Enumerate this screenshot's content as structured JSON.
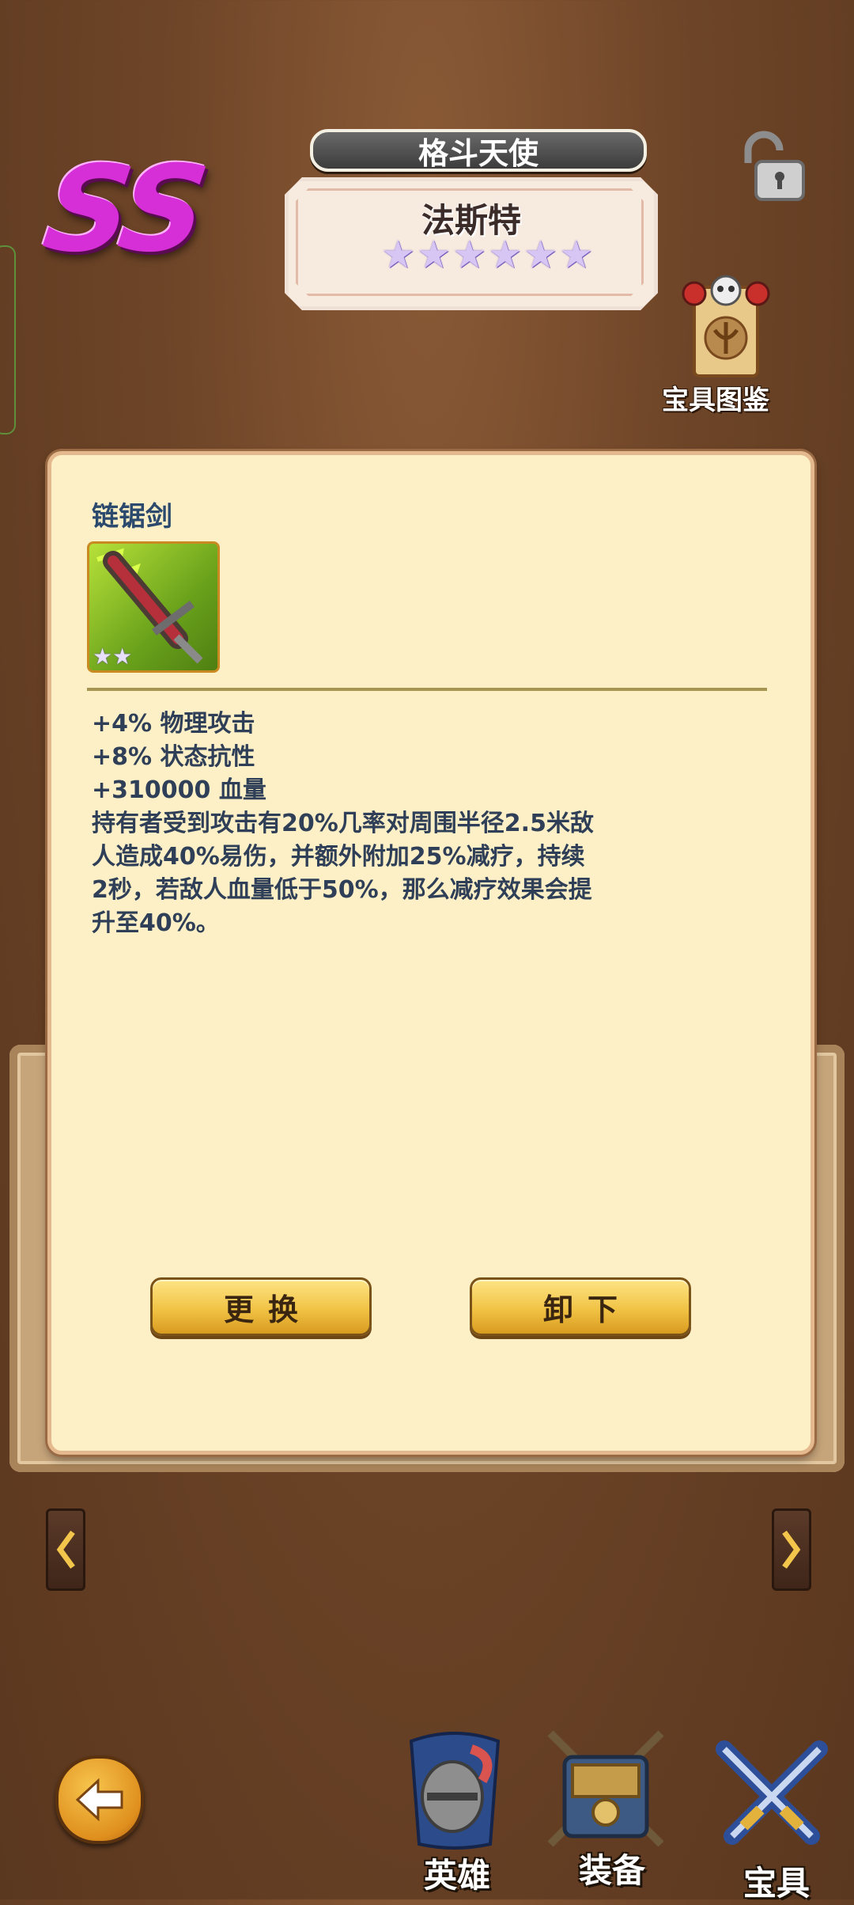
{
  "header": {
    "grade": "SS",
    "hero_class": "格斗天使",
    "hero_name": "法斯特",
    "star_count": 6
  },
  "codex": {
    "label": "宝具图鉴"
  },
  "item": {
    "name": "链锯剑",
    "icon_star_count": 2,
    "stats": [
      "+4% 物理攻击",
      "+8% 状态抗性",
      "+310000 血量"
    ],
    "description_lines": [
      "持有者受到攻击有20%几率对周围半径2.5米敌",
      "人造成40%易伤，并额外附加25%减疗，持续",
      "2秒，若敌人血量低于50%，那么减疗效果会提",
      "升至40%。"
    ]
  },
  "buttons": {
    "replace": "更换",
    "unequip": "卸下"
  },
  "bottom_tabs": [
    {
      "label": "英雄",
      "icon": "hero-helmet-icon"
    },
    {
      "label": "装备",
      "icon": "equipment-chest-icon"
    },
    {
      "label": "宝具",
      "icon": "crossed-swords-icon"
    }
  ],
  "colors": {
    "grade": "#d62fd8",
    "panel_bg": "#fdf0c6",
    "text_blue": "#2f3f58",
    "button_gold": "#f1c345"
  }
}
